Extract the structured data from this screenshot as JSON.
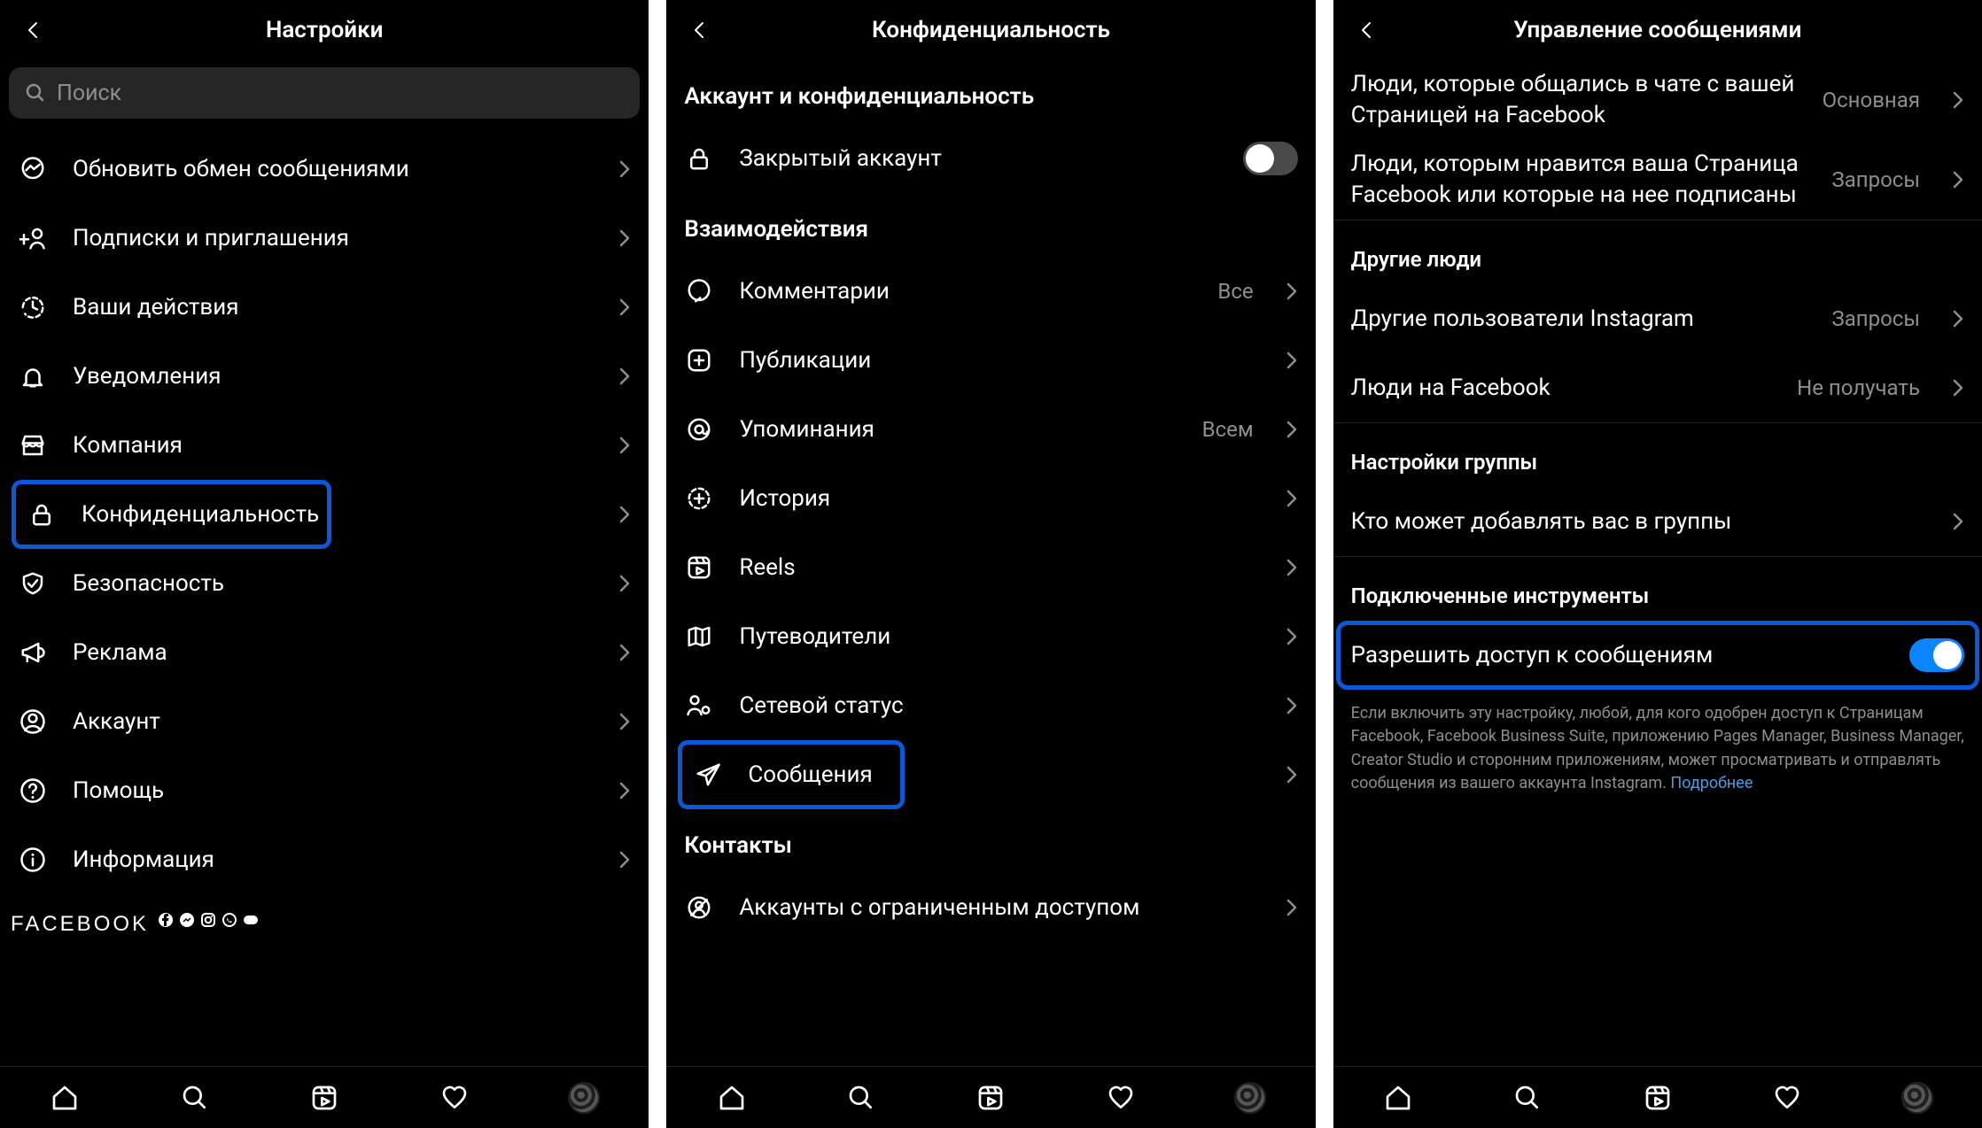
{
  "s1": {
    "title": "Настройки",
    "search_placeholder": "Поиск",
    "items": {
      "messaging": "Обновить обмен сообщениями",
      "follows": "Подписки и приглашения",
      "activity": "Ваши действия",
      "notifications": "Уведомления",
      "business": "Компания",
      "privacy": "Конфиденциальность",
      "security": "Безопасность",
      "ads": "Реклама",
      "account": "Аккаунт",
      "help": "Помощь",
      "about": "Информация"
    },
    "footer_brand": "FACEBOOK"
  },
  "s2": {
    "title": "Конфиденциальность",
    "sec_account": "Аккаунт и конфиденциальность",
    "private_account": "Закрытый аккаунт",
    "sec_interactions": "Взаимодействия",
    "items": {
      "comments": "Комментарии",
      "comments_val": "Все",
      "posts": "Публикации",
      "mentions": "Упоминания",
      "mentions_val": "Всем",
      "story": "История",
      "reels": "Reels",
      "guides": "Путеводители",
      "active_status": "Сетевой статус",
      "messages": "Сообщения"
    },
    "sec_contacts": "Контакты",
    "restricted": "Аккаунты с ограниченным доступом"
  },
  "s3": {
    "title": "Управление сообщениями",
    "rows": {
      "chat_page": "Люди, которые общались в чате с вашей Страницей на Facebook",
      "chat_page_val": "Основная",
      "likes_page": "Люди, которым нравится ваша Страница Facebook или которые на нее подписаны",
      "likes_page_val": "Запросы",
      "others_h": "Другие люди",
      "others_ig": "Другие пользователи Instagram",
      "others_ig_val": "Запросы",
      "people_fb": "Люди на Facebook",
      "people_fb_val": "Не получать",
      "group_h": "Настройки группы",
      "group_who": "Кто может добавлять вас в группы",
      "tools_h": "Подключенные инструменты",
      "allow_msg": "Разрешить доступ к сообщениям"
    },
    "disclaimer": "Если включить эту настройку, любой, для кого одобрен доступ к Страницам Facebook, Facebook Business Suite, приложению Pages Manager, Business Manager, Creator Studio и сторонним приложениям, может просматривать и отправлять сообщения из вашего аккаунта Instagram. ",
    "learn_more": "Подробнее"
  }
}
